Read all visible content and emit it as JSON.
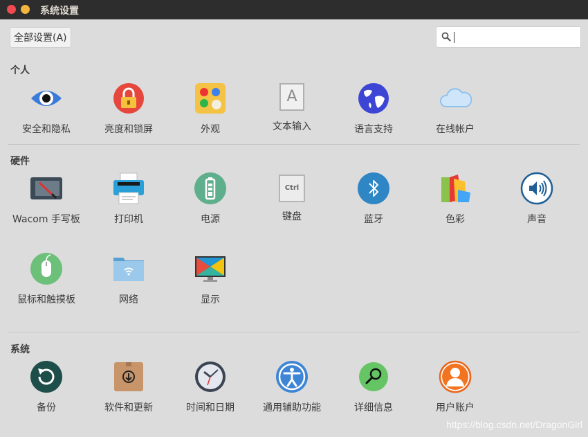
{
  "window": {
    "title": "系统设置"
  },
  "toolbar": {
    "all_settings_label": "全部设置(A)",
    "search_value": ""
  },
  "sections": {
    "personal": {
      "title": "个人",
      "items": [
        "安全和隐私",
        "亮度和锁屏",
        "外观",
        "文本输入",
        "语言支持",
        "在线帐户"
      ]
    },
    "hardware": {
      "title": "硬件",
      "items": [
        "Wacom 手写板",
        "打印机",
        "电源",
        "键盘",
        "蓝牙",
        "色彩",
        "声音",
        "鼠标和触摸板",
        "网络",
        "显示"
      ]
    },
    "system": {
      "title": "系统",
      "items": [
        "备份",
        "软件和更新",
        "时间和日期",
        "通用辅助功能",
        "详细信息",
        "用户账户"
      ]
    }
  },
  "icon_text": {
    "text_entry_letter": "A",
    "keyboard_key": "Ctrl"
  },
  "watermark": "https://blog.csdn.net/DragonGirl",
  "colors": {
    "titlebar": "#2d2d2d",
    "background": "#dcdcdc",
    "close": "#f04a50",
    "minimize": "#f4b53f"
  }
}
